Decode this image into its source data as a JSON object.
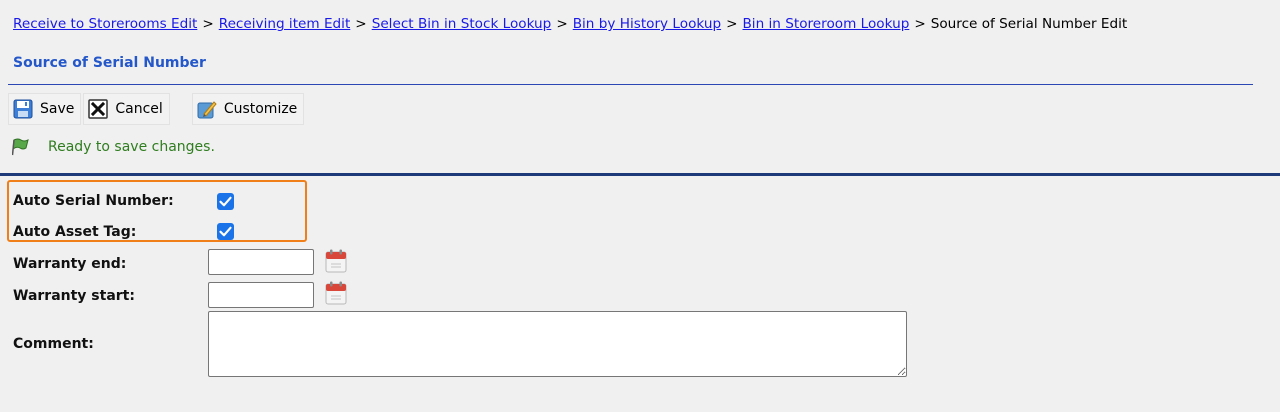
{
  "breadcrumb": {
    "links": [
      "Receive to Storerooms Edit",
      "Receiving item Edit",
      "Select Bin in Stock Lookup",
      "Bin by History Lookup",
      "Bin in Storeroom Lookup"
    ],
    "separator": ">",
    "current": "Source of Serial Number Edit"
  },
  "page_title": "Source of Serial Number",
  "toolbar": {
    "save_label": "Save",
    "cancel_label": "Cancel",
    "customize_label": "Customize"
  },
  "status": {
    "message": "Ready to save changes."
  },
  "form": {
    "auto_serial_number": {
      "label": "Auto Serial Number:",
      "checked": true
    },
    "auto_asset_tag": {
      "label": "Auto Asset Tag:",
      "checked": true
    },
    "warranty_end": {
      "label": "Warranty end:",
      "value": ""
    },
    "warranty_start": {
      "label": "Warranty start:",
      "value": ""
    },
    "comment": {
      "label": "Comment:",
      "value": ""
    }
  },
  "colors": {
    "link": "#1a1ae6",
    "title": "#2457c9",
    "status_text": "#2f7d1f",
    "checkbox": "#1a73e8",
    "highlight": "#f07f1a",
    "rule": "#1f3a78"
  }
}
